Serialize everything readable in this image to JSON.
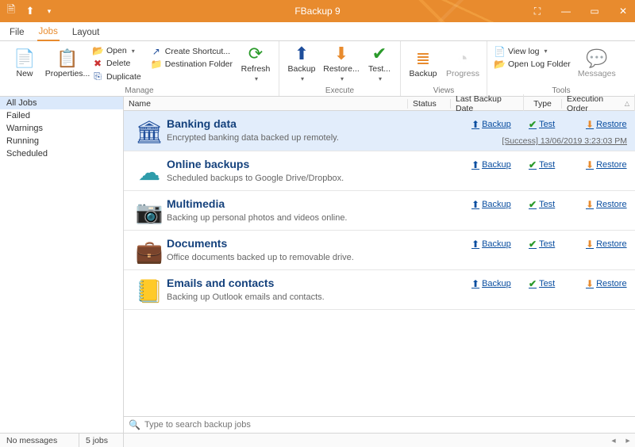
{
  "title": "FBackup 9",
  "menus": {
    "file": "File",
    "jobs": "Jobs",
    "layout": "Layout"
  },
  "ribbon": {
    "new": "New",
    "properties": "Properties...",
    "open": "Open",
    "delete": "Delete",
    "duplicate": "Duplicate",
    "createShortcut": "Create Shortcut...",
    "destinationFolder": "Destination Folder",
    "refresh": "Refresh",
    "backup": "Backup",
    "restore": "Restore...",
    "test": "Test...",
    "backup2": "Backup",
    "progress": "Progress",
    "viewLog": "View log",
    "openLogFolder": "Open Log Folder",
    "messages": "Messages",
    "groups": {
      "manage": "Manage",
      "execute": "Execute",
      "views": "Views",
      "tools": "Tools"
    }
  },
  "sidebar": [
    "All Jobs",
    "Failed",
    "Warnings",
    "Running",
    "Scheduled"
  ],
  "columns": {
    "name": "Name",
    "status": "Status",
    "lastBackup": "Last Backup Date",
    "type": "Type",
    "execOrder": "Execution Order"
  },
  "jobs": [
    {
      "title": "Banking data",
      "desc": "Encrypted banking data backed up remotely.",
      "icon": "bank",
      "color": "c-blue",
      "status": "[Success] 13/06/2019 3:23:03 PM",
      "active": true
    },
    {
      "title": "Online backups",
      "desc": "Scheduled backups to Google Drive/Dropbox.",
      "icon": "cloud",
      "color": "c-teal"
    },
    {
      "title": "Multimedia",
      "desc": "Backing up personal photos and videos online.",
      "icon": "camera",
      "color": "c-purple"
    },
    {
      "title": "Documents",
      "desc": "Office documents backed up to removable drive.",
      "icon": "briefcase",
      "color": "c-dbrown"
    },
    {
      "title": "Emails and contacts",
      "desc": "Backing up Outlook emails and contacts.",
      "icon": "contact",
      "color": "c-orange"
    }
  ],
  "jobActions": {
    "backup": "Backup",
    "test": "Test",
    "restore": "Restore"
  },
  "search": {
    "placeholder": "Type to search backup jobs"
  },
  "statusbar": {
    "messages": "No messages",
    "jobs": "5 jobs"
  }
}
